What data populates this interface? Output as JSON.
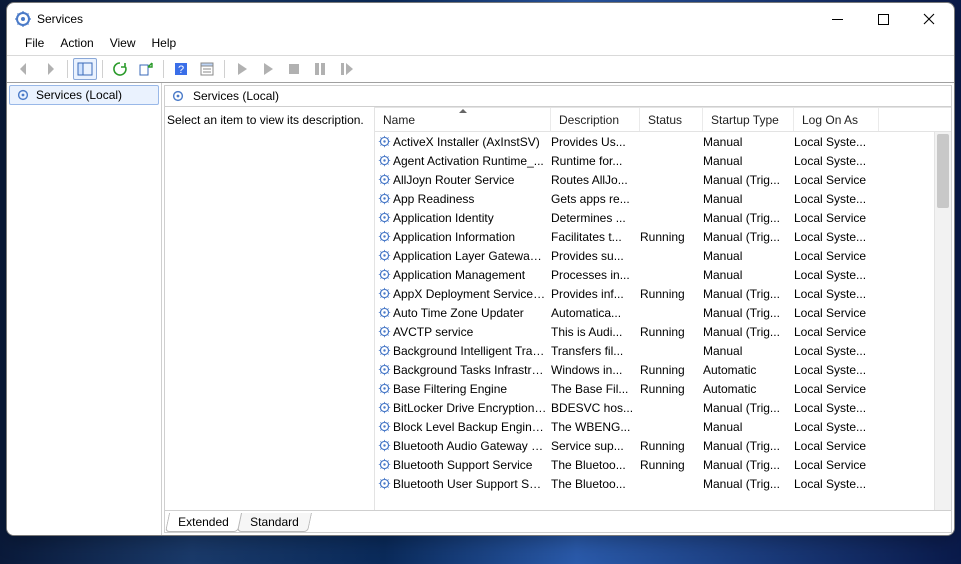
{
  "window": {
    "title": "Services"
  },
  "menu": {
    "file": "File",
    "action": "Action",
    "view": "View",
    "help": "Help"
  },
  "nav": {
    "services_local": "Services (Local)"
  },
  "main": {
    "header": "Services (Local)",
    "prompt": "Select an item to view its description.",
    "columns": {
      "name": "Name",
      "description": "Description",
      "status": "Status",
      "startup": "Startup Type",
      "logon": "Log On As"
    },
    "rows": [
      {
        "name": "ActiveX Installer (AxInstSV)",
        "desc": "Provides Us...",
        "status": "",
        "startup": "Manual",
        "logon": "Local Syste..."
      },
      {
        "name": "Agent Activation Runtime_...",
        "desc": "Runtime for...",
        "status": "",
        "startup": "Manual",
        "logon": "Local Syste..."
      },
      {
        "name": "AllJoyn Router Service",
        "desc": "Routes AllJo...",
        "status": "",
        "startup": "Manual (Trig...",
        "logon": "Local Service"
      },
      {
        "name": "App Readiness",
        "desc": "Gets apps re...",
        "status": "",
        "startup": "Manual",
        "logon": "Local Syste..."
      },
      {
        "name": "Application Identity",
        "desc": "Determines ...",
        "status": "",
        "startup": "Manual (Trig...",
        "logon": "Local Service"
      },
      {
        "name": "Application Information",
        "desc": "Facilitates t...",
        "status": "Running",
        "startup": "Manual (Trig...",
        "logon": "Local Syste..."
      },
      {
        "name": "Application Layer Gateway ...",
        "desc": "Provides su...",
        "status": "",
        "startup": "Manual",
        "logon": "Local Service"
      },
      {
        "name": "Application Management",
        "desc": "Processes in...",
        "status": "",
        "startup": "Manual",
        "logon": "Local Syste..."
      },
      {
        "name": "AppX Deployment Service (...",
        "desc": "Provides inf...",
        "status": "Running",
        "startup": "Manual (Trig...",
        "logon": "Local Syste..."
      },
      {
        "name": "Auto Time Zone Updater",
        "desc": "Automatica...",
        "status": "",
        "startup": "Manual (Trig...",
        "logon": "Local Service"
      },
      {
        "name": "AVCTP service",
        "desc": "This is Audi...",
        "status": "Running",
        "startup": "Manual (Trig...",
        "logon": "Local Service"
      },
      {
        "name": "Background Intelligent Tran...",
        "desc": "Transfers fil...",
        "status": "",
        "startup": "Manual",
        "logon": "Local Syste..."
      },
      {
        "name": "Background Tasks Infrastruc...",
        "desc": "Windows in...",
        "status": "Running",
        "startup": "Automatic",
        "logon": "Local Syste..."
      },
      {
        "name": "Base Filtering Engine",
        "desc": "The Base Fil...",
        "status": "Running",
        "startup": "Automatic",
        "logon": "Local Service"
      },
      {
        "name": "BitLocker Drive Encryption ...",
        "desc": "BDESVC hos...",
        "status": "",
        "startup": "Manual (Trig...",
        "logon": "Local Syste..."
      },
      {
        "name": "Block Level Backup Engine ...",
        "desc": "The WBENG...",
        "status": "",
        "startup": "Manual",
        "logon": "Local Syste..."
      },
      {
        "name": "Bluetooth Audio Gateway S...",
        "desc": "Service sup...",
        "status": "Running",
        "startup": "Manual (Trig...",
        "logon": "Local Service"
      },
      {
        "name": "Bluetooth Support Service",
        "desc": "The Bluetoo...",
        "status": "Running",
        "startup": "Manual (Trig...",
        "logon": "Local Service"
      },
      {
        "name": "Bluetooth User Support Ser...",
        "desc": "The Bluetoo...",
        "status": "",
        "startup": "Manual (Trig...",
        "logon": "Local Syste..."
      }
    ]
  },
  "tabs": {
    "extended": "Extended",
    "standard": "Standard"
  }
}
